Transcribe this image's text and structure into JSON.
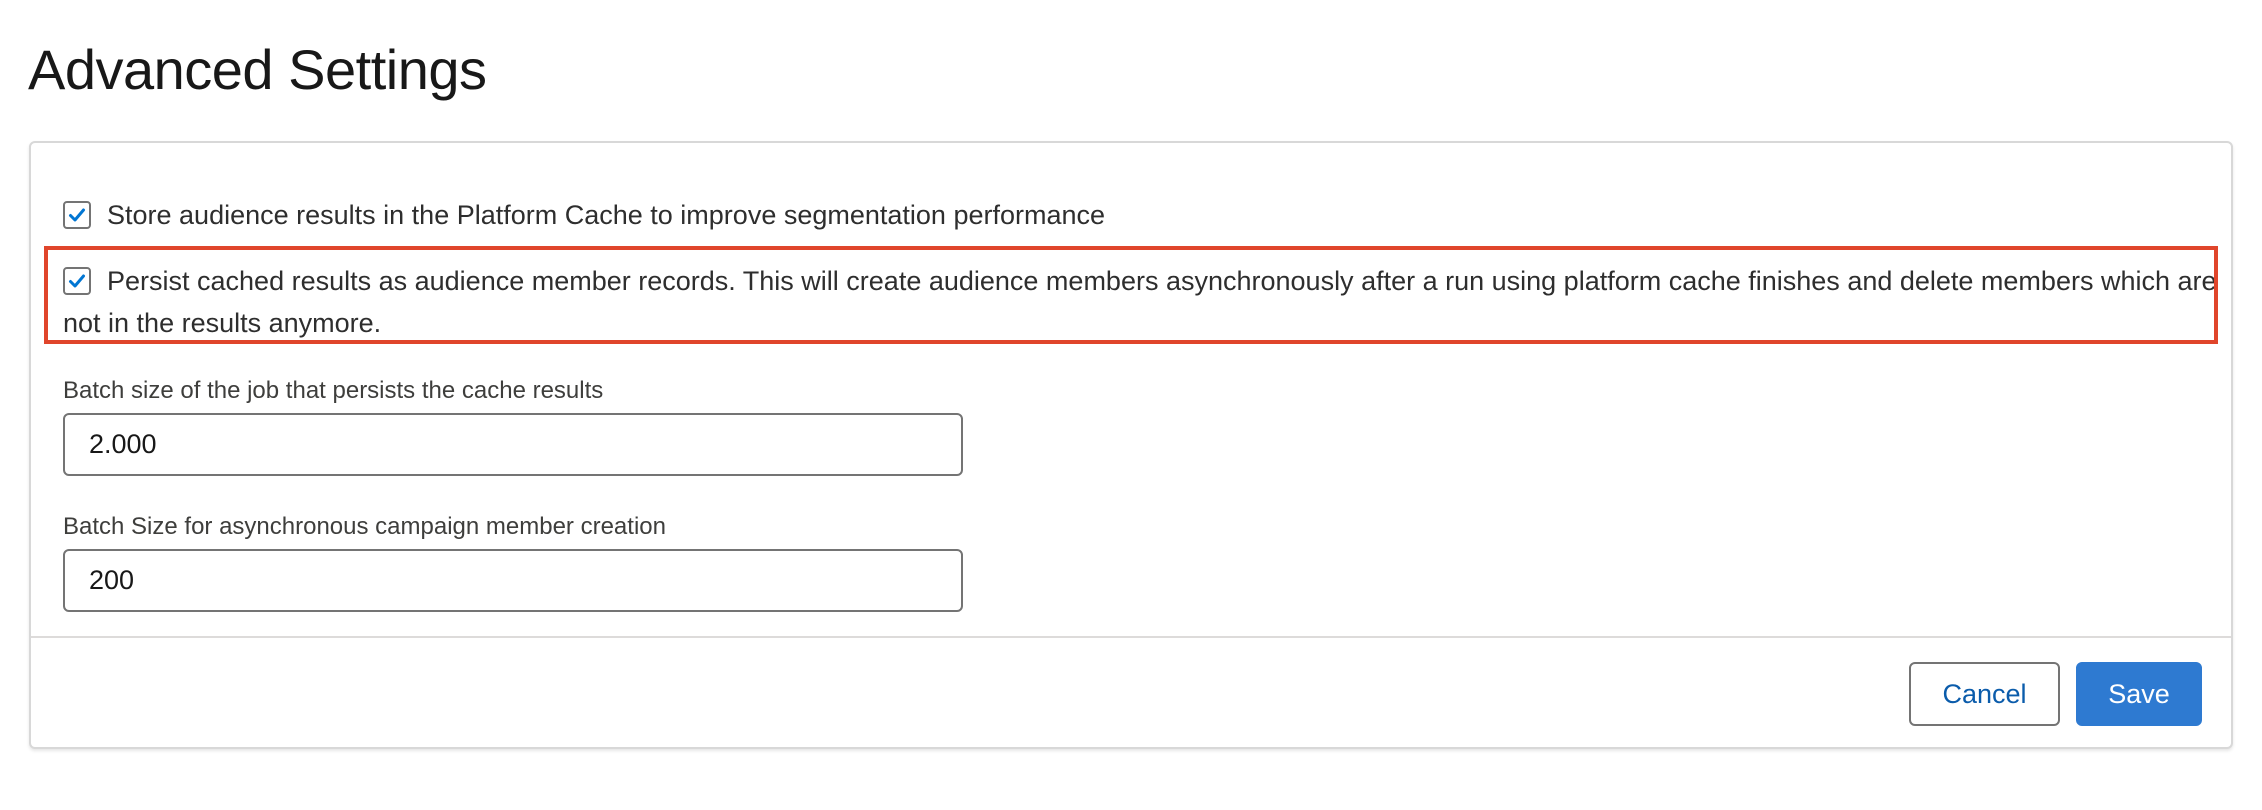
{
  "page": {
    "title": "Advanced Settings"
  },
  "options": [
    {
      "checked": true,
      "label": "Store audience results in the Platform Cache to improve segmentation performance"
    },
    {
      "checked": true,
      "label": "Persist cached results as audience member records. This will create audience members asynchronously after a run using platform cache finishes and delete members which are not in the results anymore."
    }
  ],
  "fields": [
    {
      "label": "Batch size of the job that persists the cache results",
      "value": "2.000"
    },
    {
      "label": "Batch Size for asynchronous campaign member creation",
      "value": "200"
    }
  ],
  "footer": {
    "cancel_label": "Cancel",
    "save_label": "Save"
  },
  "colors": {
    "accent": "#2e7ad1",
    "link": "#0b5cab",
    "highlight_border": "#e0452b",
    "checkmark": "#0176d3"
  },
  "icons": {
    "checkbox_mark": "check-icon"
  }
}
